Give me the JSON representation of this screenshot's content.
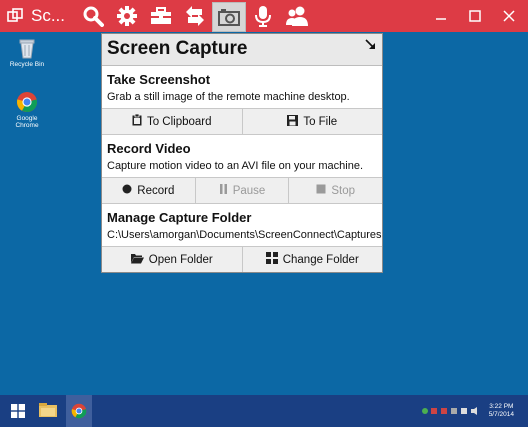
{
  "window": {
    "title": "Sc..."
  },
  "toolbar": {
    "icons": [
      "search-icon",
      "gear-icon",
      "toolbox-icon",
      "swap-icon",
      "camera-icon",
      "microphone-icon",
      "users-icon"
    ],
    "active": "camera-icon"
  },
  "desktop": {
    "icons": [
      {
        "label": "Recycle Bin"
      },
      {
        "label": "Google Chrome"
      }
    ]
  },
  "panel": {
    "title": "Screen Capture",
    "screenshot": {
      "title": "Take Screenshot",
      "description": "Grab a still image of the remote machine desktop.",
      "clipboard_label": "To Clipboard",
      "file_label": "To File"
    },
    "video": {
      "title": "Record Video",
      "description": "Capture motion video to an AVI file on your machine.",
      "record_label": "Record",
      "pause_label": "Pause",
      "stop_label": "Stop"
    },
    "folder": {
      "title": "Manage Capture Folder",
      "path": "C:\\Users\\amorgan\\Documents\\ScreenConnect\\Captures",
      "open_label": "Open Folder",
      "change_label": "Change Folder"
    }
  },
  "taskbar": {
    "time": "3:22 PM",
    "date": "5/7/2014"
  },
  "colors": {
    "titlebar": "#dd3b45",
    "desktop": "#0c68a5",
    "taskbar": "#1a3f83"
  }
}
